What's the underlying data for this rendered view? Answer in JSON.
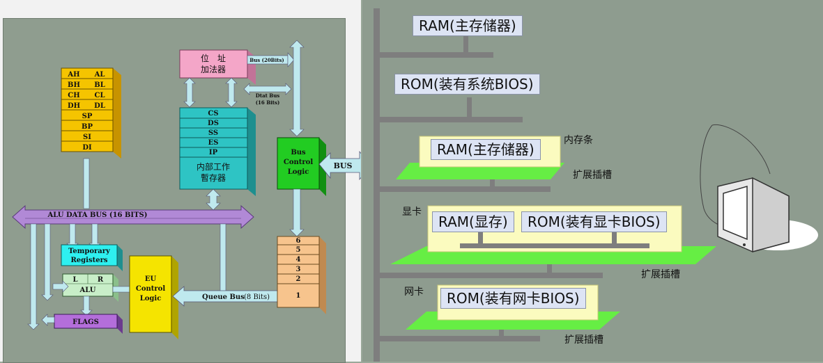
{
  "cpu": {
    "registers_general": [
      [
        "AH",
        "AL"
      ],
      [
        "BH",
        "BL"
      ],
      [
        "CH",
        "CL"
      ],
      [
        "DH",
        "DL"
      ]
    ],
    "registers_pointer": [
      "SP",
      "BP",
      "SI",
      "DI"
    ],
    "adder_label": [
      "位　址",
      "加法器"
    ],
    "bus_20": "Bus (20Bits)",
    "dtat_bus": [
      "Dtat Bus",
      "(16 Bits)"
    ],
    "segment_registers": [
      "CS",
      "DS",
      "SS",
      "ES",
      "IP"
    ],
    "internal_regs": [
      "内部工作",
      "暫存器"
    ],
    "bus_control": [
      "Bus",
      "Control",
      "Logic"
    ],
    "bus_label": "BUS",
    "alu_bus": "ALU DATA BUS (16 BITS)",
    "temp_regs": [
      "Temporary",
      "Registers"
    ],
    "alu_L": "L",
    "alu_R": "R",
    "alu": "ALU",
    "flags": "FLAGS",
    "eu_control": [
      "EU",
      "Control",
      "Logic"
    ],
    "queue_bus": "Queue  Bus",
    "queue_bits": "(8 Bits)",
    "queue": [
      "6",
      "5",
      "4",
      "3",
      "2",
      "1"
    ]
  },
  "system": {
    "ram_main": "RAM(主存储器)",
    "rom_bios": "ROM(装有系统BIOS)",
    "memory_stick_label": "内存条",
    "memory_ram": "RAM(主存储器)",
    "slot_1": "扩展插槽",
    "video_card_label": "显卡",
    "video_ram": "RAM(显存)",
    "video_rom": "ROM(装有显卡BIOS)",
    "slot_2": "扩展插槽",
    "net_card_label": "网卡",
    "net_rom": "ROM(装有网卡BIOS)",
    "slot_3": "扩展插槽"
  },
  "colors": {
    "register_yellow": "#f5c400",
    "adder_pink": "#f4a6c8",
    "segment_teal": "#2ec4c4",
    "bus_green": "#22cc22",
    "alu_bus_purple": "#b189d6",
    "eu_yellow": "#f5e400",
    "queue_orange": "#f7c48d",
    "slot_green": "#66ee44",
    "card_yellow": "#fbfbbf"
  }
}
